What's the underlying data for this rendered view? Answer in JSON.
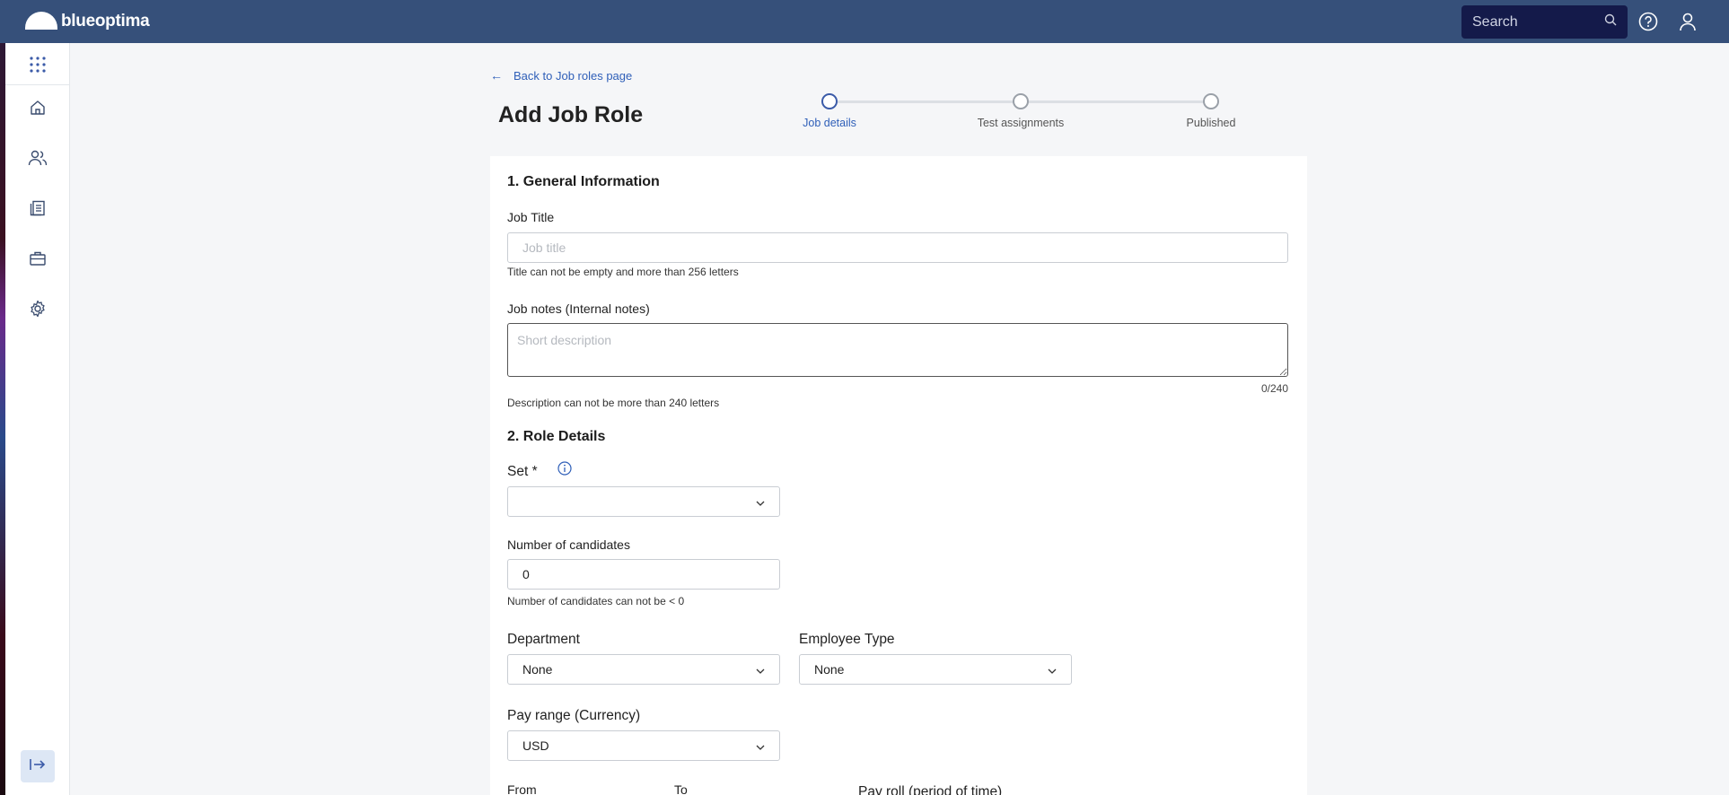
{
  "app": {
    "brand": "blueoptima",
    "search_placeholder": "Search"
  },
  "topbar_icons": [
    "help-icon",
    "user-icon"
  ],
  "sidebar": {
    "items": [
      {
        "icon": "apps-grid-icon"
      },
      {
        "icon": "home-icon"
      },
      {
        "icon": "users-icon"
      },
      {
        "icon": "tests-icon"
      },
      {
        "icon": "briefcase-icon"
      },
      {
        "icon": "settings-icon"
      }
    ],
    "collapse_icon": "expand-sidebar-icon"
  },
  "header": {
    "back_link": "Back to Job roles page",
    "title": "Add Job Role"
  },
  "stepper": {
    "steps": [
      {
        "label": "Job details",
        "active": true
      },
      {
        "label": "Test assignments",
        "active": false
      },
      {
        "label": "Published",
        "active": false
      }
    ]
  },
  "form": {
    "section1_title": "1. General Information",
    "job_title": {
      "label": "Job Title",
      "placeholder": "Job title",
      "value": "",
      "helper": "Title can not be empty and more than 256 letters"
    },
    "job_notes": {
      "label": "Job notes (Internal notes)",
      "placeholder": "Short description",
      "value": "",
      "counter": "0/240",
      "helper": "Description can not be more than 240 letters"
    },
    "section2_title": "2. Role Details",
    "set": {
      "label": "Set *",
      "value": ""
    },
    "candidates": {
      "label": "Number of candidates",
      "value": "0",
      "helper": "Number of candidates can not be < 0"
    },
    "department": {
      "label": "Department",
      "value": "None"
    },
    "employee_type": {
      "label": "Employee Type",
      "value": "None"
    },
    "pay_range": {
      "label": "Pay range (Currency)",
      "value": "USD"
    },
    "from_label": "From",
    "to_label": "To",
    "payroll_label": "Pay roll (period of time)"
  },
  "colors": {
    "topbar": "#36507a",
    "search_bg": "#141a4a",
    "accent": "#2f5fb8"
  }
}
